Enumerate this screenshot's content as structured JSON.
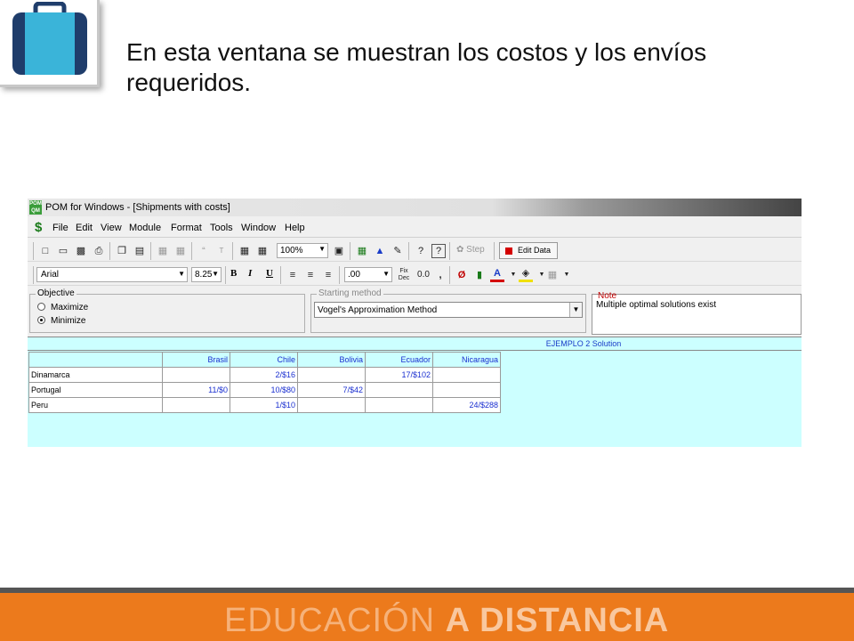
{
  "slide": {
    "text": "En esta ventana se muestran los costos y los envíos requeridos.",
    "icon": "briefcase-icon",
    "footer_light": "EDUCACIÓN ",
    "footer_bold": "A DISTANCIA",
    "colors": {
      "footer": "#ec7a1c",
      "briefcase": "#3ab4d9"
    }
  },
  "window": {
    "title": "POM for Windows - [Shipments with costs]",
    "app_icon_text": "POM QM",
    "menu": [
      "File",
      "Edit",
      "View",
      "Module",
      "Format",
      "Tools",
      "Window",
      "Help"
    ],
    "toolbar": {
      "zoom": "100%",
      "step_label": "Step",
      "edit_data_label": "Edit Data",
      "font": "Arial",
      "font_size": "8.25",
      "bold": "B",
      "italic": "I",
      "underline": "U",
      "decimals": ".00",
      "fix_dec": "Fix Dec",
      "zero_zero": "0.0",
      "comma": ","
    },
    "objective": {
      "legend": "Objective",
      "options": [
        {
          "label": "Maximize",
          "selected": false
        },
        {
          "label": "Minimize",
          "selected": true
        }
      ]
    },
    "starting_method": {
      "legend": "Starting method",
      "value": "Vogel's Approximation Method"
    },
    "note": {
      "legend": "Note",
      "text": "Multiple optimal solutions exist"
    },
    "solution": {
      "title": "EJEMPLO 2 Solution",
      "columns": [
        "Brasil",
        "Chile",
        "Bolivia",
        "Ecuador",
        "Nicaragua"
      ],
      "rows": [
        {
          "name": "Dinamarca",
          "cells": [
            "",
            "2/$16",
            "",
            "17/$102",
            ""
          ]
        },
        {
          "name": "Portugal",
          "cells": [
            "11/$0",
            "10/$80",
            "7/$42",
            "",
            ""
          ]
        },
        {
          "name": "Peru",
          "cells": [
            "",
            "1/$10",
            "",
            "",
            "24/$288"
          ]
        }
      ]
    }
  }
}
